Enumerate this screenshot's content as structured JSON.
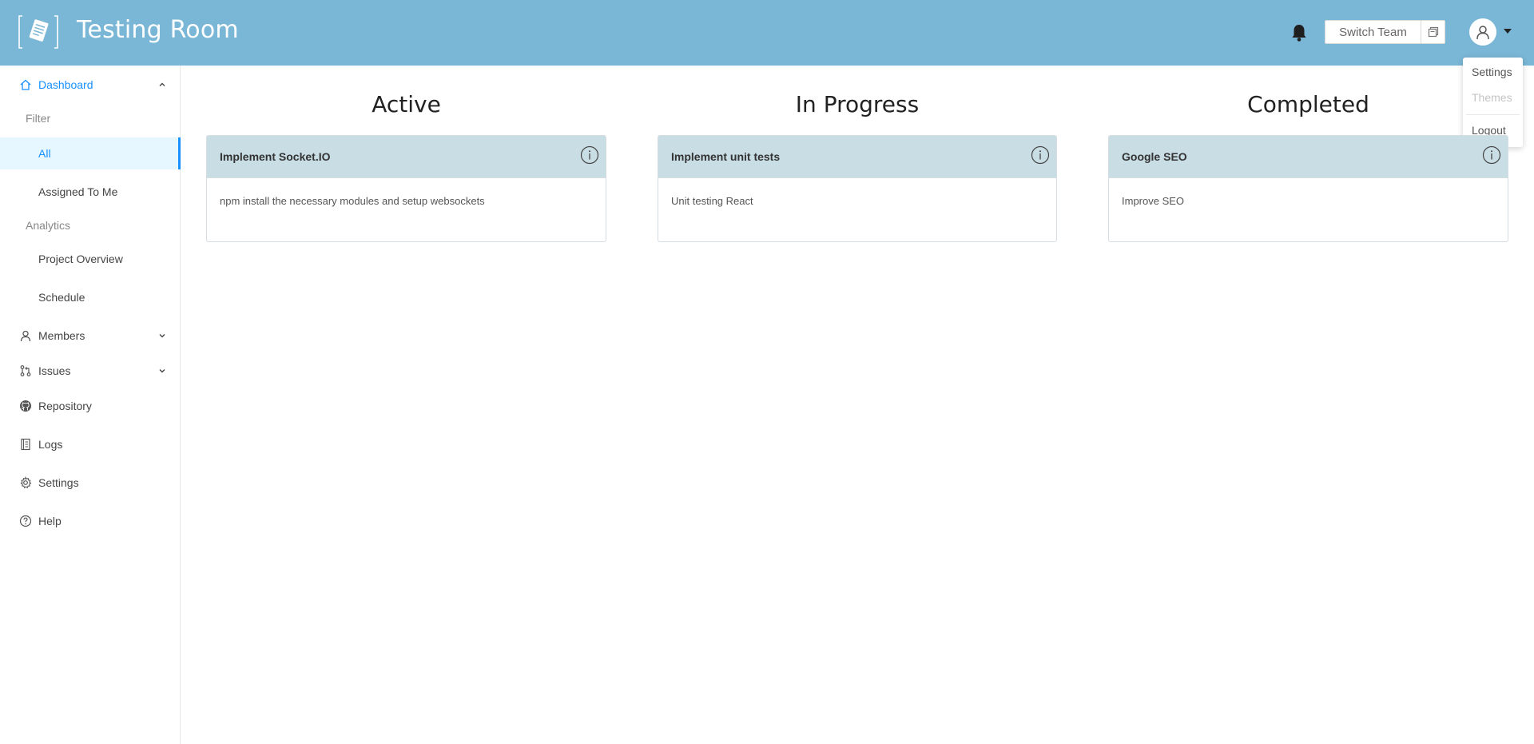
{
  "header": {
    "title": "Testing Room",
    "switch_team_label": "Switch Team",
    "bg_color": "#7ab6d5",
    "icons": [
      "logo-icon",
      "bell-icon",
      "switch-team-icon",
      "user-avatar-icon",
      "caret-down-icon"
    ]
  },
  "user_menu": {
    "items": [
      {
        "label": "Settings",
        "disabled": false
      },
      {
        "label": "Themes",
        "disabled": true
      },
      {
        "label": "Logout",
        "disabled": false
      }
    ]
  },
  "sidebar": {
    "dashboard": {
      "label": "Dashboard",
      "expanded": true
    },
    "filter_title": "Filter",
    "filter_items": [
      {
        "label": "All",
        "selected": true
      },
      {
        "label": "Assigned To Me",
        "selected": false
      }
    ],
    "analytics_title": "Analytics",
    "analytics_items": [
      {
        "label": "Project Overview"
      },
      {
        "label": "Schedule"
      }
    ],
    "items": [
      {
        "label": "Members",
        "icon": "user-icon",
        "expandable": true
      },
      {
        "label": "Issues",
        "icon": "pull-request-icon",
        "expandable": true
      },
      {
        "label": "Repository",
        "icon": "github-icon",
        "expandable": false
      },
      {
        "label": "Logs",
        "icon": "log-icon",
        "expandable": false
      },
      {
        "label": "Settings",
        "icon": "gear-icon",
        "expandable": false
      },
      {
        "label": "Help",
        "icon": "help-icon",
        "expandable": false
      }
    ],
    "accent_color": "#1890ff"
  },
  "board": {
    "columns": [
      {
        "title": "Active",
        "cards": [
          {
            "title": "Implement Socket.IO",
            "description": "npm install the necessary modules and setup websockets"
          }
        ]
      },
      {
        "title": "In Progress",
        "cards": [
          {
            "title": "Implement unit tests",
            "description": "Unit testing React"
          }
        ]
      },
      {
        "title": "Completed",
        "cards": [
          {
            "title": "Google SEO",
            "description": "Improve SEO"
          }
        ]
      }
    ]
  }
}
